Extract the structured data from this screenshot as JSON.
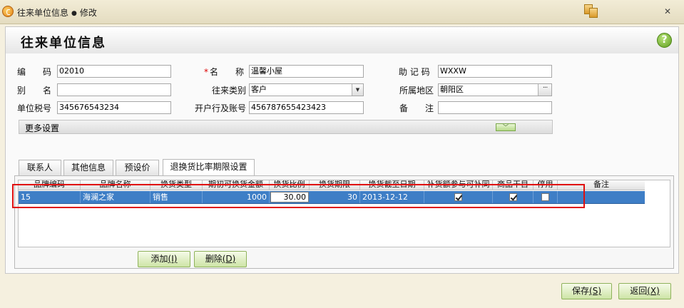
{
  "window": {
    "title": "往来单位信息",
    "separator": "●",
    "mode": "修改"
  },
  "page_title": "往来单位信息",
  "form": {
    "code": {
      "label": "编　　码",
      "value": "02010"
    },
    "name": {
      "required_mark": "*",
      "label": "名　　称",
      "value": "温馨小屋"
    },
    "mnemonic": {
      "label": "助 记 码",
      "value": "WXXW"
    },
    "alias": {
      "label": "别　　名",
      "value": ""
    },
    "partner_type": {
      "label": "往来类别",
      "value": "客户"
    },
    "region": {
      "label": "所属地区",
      "value": "朝阳区"
    },
    "tax_no": {
      "label": "单位税号",
      "value": "345676543234"
    },
    "bank_account": {
      "label": "开户行及账号",
      "value": "456787655423423"
    },
    "remark": {
      "label": "备　　注",
      "value": ""
    }
  },
  "more_settings_label": "更多设置",
  "tabs": [
    {
      "label": "联系人",
      "active": false
    },
    {
      "label": "其他信息",
      "active": false
    },
    {
      "label": "预设价",
      "active": false
    },
    {
      "label": "退换货比率期限设置",
      "active": true
    }
  ],
  "grid": {
    "columns": [
      "品牌编码",
      "品牌名称",
      "换货类型",
      "期初可换货金额",
      "换货比例",
      "换货期限",
      "换货截至日期",
      "补货额参与可补同",
      "商品干目",
      "停用",
      "备注"
    ],
    "rows": [
      {
        "brand_code": "15",
        "brand_name": "海澜之家",
        "exchange_type": "销售",
        "initial_amount": "1000",
        "ratio": "30.00",
        "period": "30",
        "deadline": "2013-12-12",
        "replenish_checked": true,
        "goods_checked": true,
        "disabled_checked": false,
        "remark": ""
      }
    ]
  },
  "buttons": {
    "add": {
      "label": "添加",
      "hotkey": "(I)"
    },
    "delete": {
      "label": "删除",
      "hotkey": "(D)"
    },
    "save": {
      "label": "保存",
      "hotkey": "(S)"
    },
    "back": {
      "label": "返回",
      "hotkey": "(X)"
    }
  },
  "colors": {
    "selected_row": "#3e7ec6",
    "highlight_box": "#e01010",
    "button_green": "#cde4a6"
  }
}
